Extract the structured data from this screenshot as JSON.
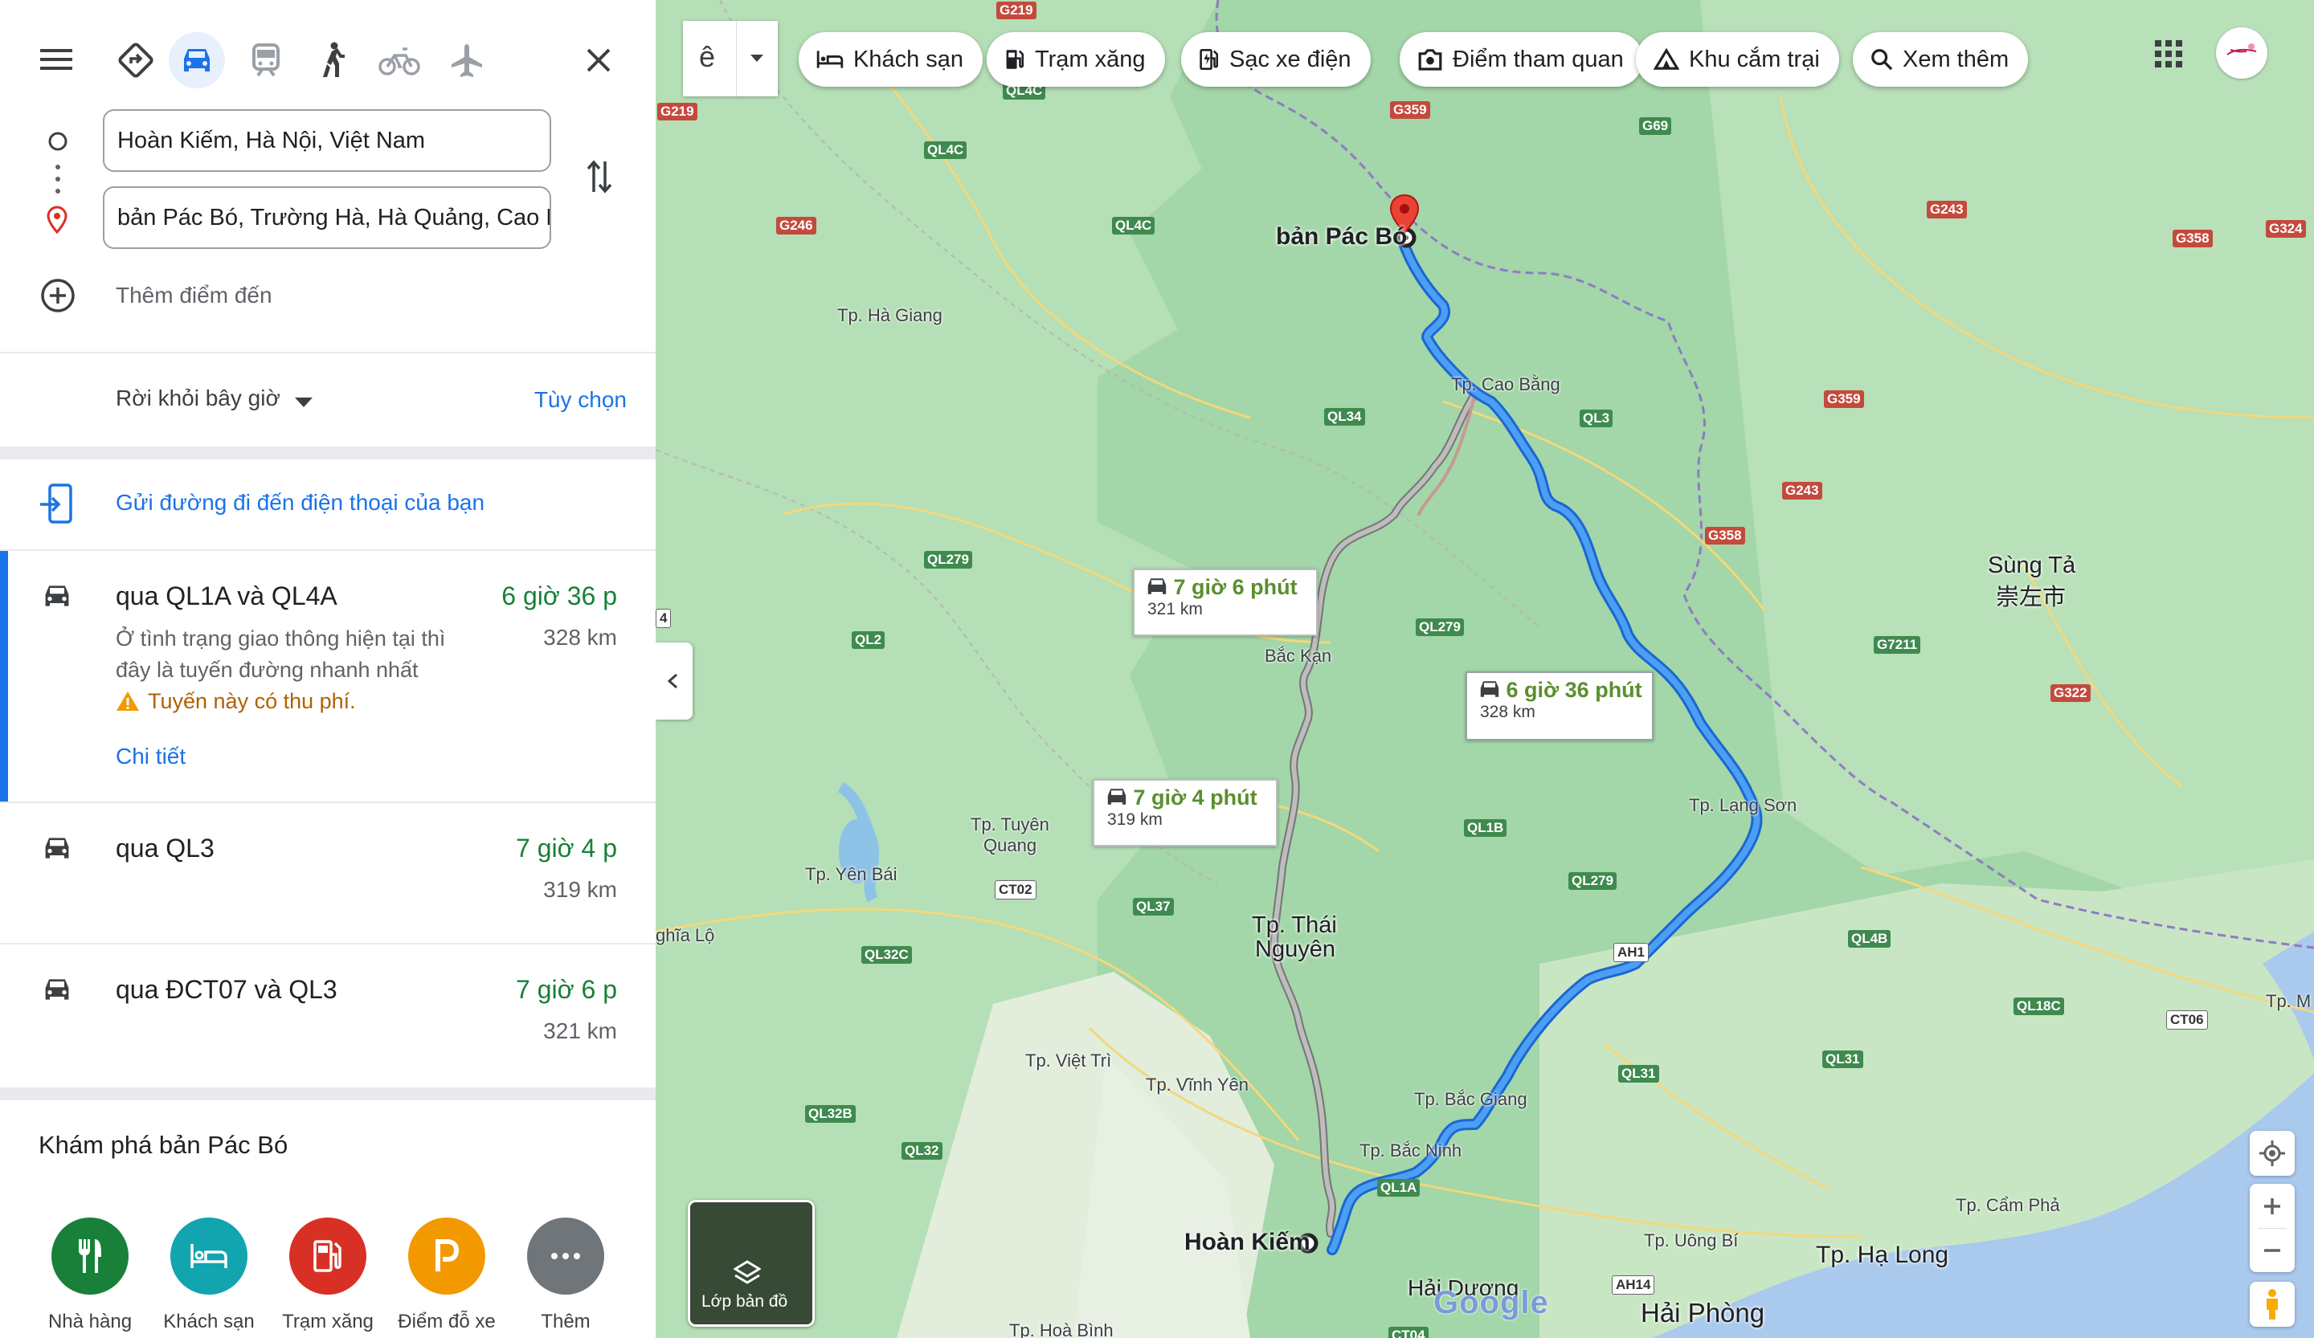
{
  "directions": {
    "origin_value": "Hoàn Kiếm, Hà Nội, Việt Nam",
    "destination_value": "bản Pác Bó, Trường Hà, Hà Quảng, Cao B",
    "add_destination": "Thêm điểm đến",
    "depart_label": "Rời khỏi bây giờ",
    "options_link": "Tùy chọn",
    "send_to_phone": "Gửi đường đi đến điện thoại của bạn",
    "travel_modes": [
      "directions",
      "driving",
      "transit",
      "walking",
      "cycling",
      "flights"
    ],
    "active_mode": "driving"
  },
  "routes": [
    {
      "title": "qua QL1A và QL4A",
      "time": "6 giờ 36 p",
      "distance": "328 km",
      "desc": "Ở tình trạng giao thông hiện tại thì đây là tuyến đường nhanh nhất",
      "warning": "Tuyến này có thu phí.",
      "details_link": "Chi tiết",
      "selected": true
    },
    {
      "title": "qua QL3",
      "time": "7 giờ 4 p",
      "distance": "319 km"
    },
    {
      "title": "qua ĐCT07 và QL3",
      "time": "7 giờ 6 p",
      "distance": "321 km"
    }
  ],
  "explore": {
    "title": "Khám phá bản Pác Bó",
    "items": [
      {
        "label": "Nhà hàng",
        "color": "#188038"
      },
      {
        "label": "Khách sạn",
        "color": "#12a4af"
      },
      {
        "label": "Trạm xăng",
        "color": "#d93025"
      },
      {
        "label": "Điểm đỗ xe",
        "color": "#f29900"
      },
      {
        "label": "Thêm",
        "color": "#70757a"
      }
    ]
  },
  "map": {
    "language_selector": "ê",
    "chips": [
      "Khách sạn",
      "Trạm xăng",
      "Sạc xe điện",
      "Điểm tham quan",
      "Khu cắm trại",
      "Xem thêm"
    ],
    "layers_label": "Lớp bản đồ",
    "logo": "Google",
    "route_colors": {
      "primary": "#1a73e8",
      "alternate": "#9e9e9e"
    },
    "callouts": [
      {
        "time": "6 giờ 36 phút",
        "distance": "328 km"
      },
      {
        "time": "7 giờ 6 phút",
        "distance": "321 km"
      },
      {
        "time": "7 giờ 4 phút",
        "distance": "319 km"
      }
    ],
    "places": {
      "start": "Hoàn Kiếm",
      "end": "bản Pác Bó",
      "cao_bang": "Tp. Cao Bằng",
      "ha_giang": "Tp. Hà Giang",
      "bac_kan": "Bắc Kạn",
      "tuyen_quang_1": "Tp. Tuyên",
      "tuyen_quang_2": "Quang",
      "yen_bai": "Tp. Yên Bái",
      "nghia_lo": "ghĩa Lộ",
      "thai_nguyen_1": "Tp. Thái",
      "thai_nguyen_2": "Nguyên",
      "lang_son": "Tp. Lạng Sơn",
      "viet_tri": "Tp. Việt Trì",
      "vinh_yen": "Tp. Vĩnh Yên",
      "bac_giang": "Tp. Bắc Giang",
      "bac_ninh": "Tp. Bắc Ninh",
      "hai_duong": "Hải Dương",
      "hai_phong": "Hải Phòng",
      "uong_bi": "Tp. Uông Bí",
      "ha_long": "Tp. Hạ Long",
      "cam_pha": "Tp. Cẩm Phả",
      "hoa_binh": "Tp. Hoà Bình",
      "sung_ta": "Sùng Tả",
      "sung_ta_cn": "崇左市",
      "tp_m": "Tp. M"
    },
    "roads": [
      "QL4C",
      "QL4C",
      "QL4C",
      "QL34",
      "QL3",
      "QL279",
      "QL279",
      "QL2",
      "QL1B",
      "QL279",
      "QL4B",
      "QL37",
      "QL32C",
      "CT02",
      "QL18C",
      "CT06",
      "QL31",
      "QL32B",
      "QL32",
      "QL31",
      "QL1A",
      "AH1",
      "AH14",
      "CT04",
      "G219",
      "G219",
      "G359",
      "G69",
      "G246",
      "G243",
      "G358",
      "G324",
      "G359",
      "G243",
      "G358",
      "G7211",
      "G322",
      "4"
    ]
  }
}
